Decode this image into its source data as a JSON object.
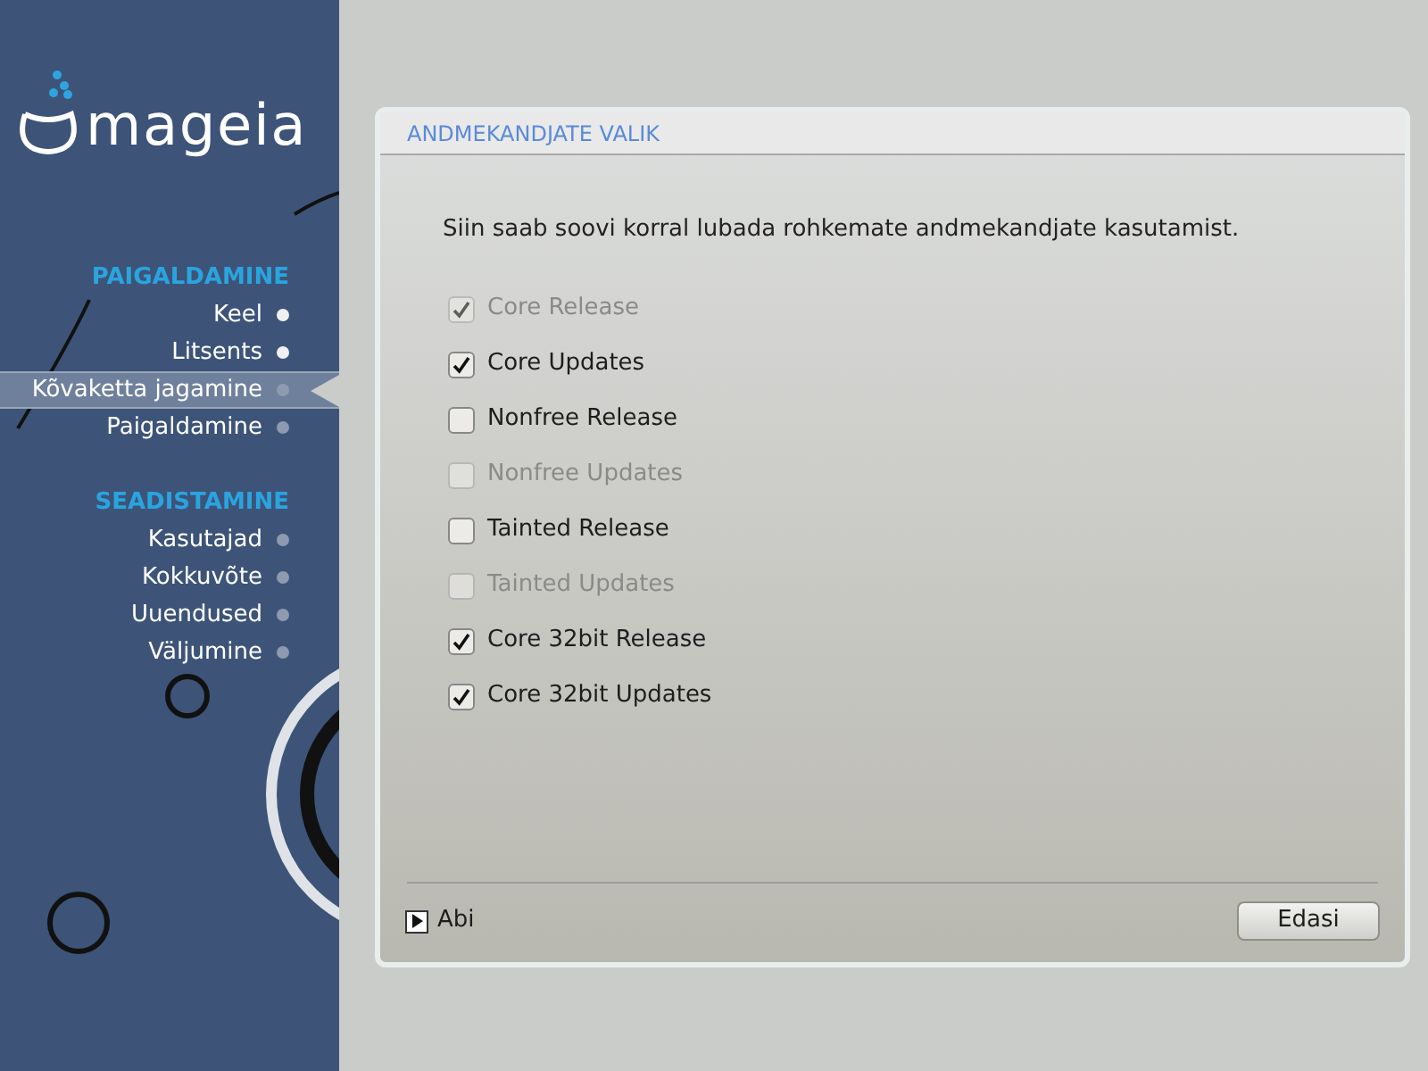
{
  "logo": {
    "text": "mageia"
  },
  "sidebar": {
    "sections": [
      {
        "title": "PAIGALDAMINE",
        "items": [
          {
            "label": "Keel",
            "selected": false,
            "done": true
          },
          {
            "label": "Litsents",
            "selected": false,
            "done": true
          },
          {
            "label": "Kõvaketta jagamine",
            "selected": true,
            "done": false
          },
          {
            "label": "Paigaldamine",
            "selected": false,
            "done": false
          }
        ]
      },
      {
        "title": "SEADISTAMINE",
        "items": [
          {
            "label": "Kasutajad",
            "selected": false,
            "done": false
          },
          {
            "label": "Kokkuvõte",
            "selected": false,
            "done": false
          },
          {
            "label": "Uuendused",
            "selected": false,
            "done": false
          },
          {
            "label": "Väljumine",
            "selected": false,
            "done": false
          }
        ]
      }
    ]
  },
  "panel": {
    "title": "ANDMEKANDJATE VALIK",
    "description": "Siin saab soovi korral lubada rohkemate andmekandjate kasutamist.",
    "options": [
      {
        "label": "Core Release",
        "checked": true,
        "disabled": true
      },
      {
        "label": "Core Updates",
        "checked": true,
        "disabled": false
      },
      {
        "label": "Nonfree Release",
        "checked": false,
        "disabled": false
      },
      {
        "label": "Nonfree Updates",
        "checked": false,
        "disabled": true
      },
      {
        "label": "Tainted Release",
        "checked": false,
        "disabled": false
      },
      {
        "label": "Tainted Updates",
        "checked": false,
        "disabled": true
      },
      {
        "label": "Core 32bit Release",
        "checked": true,
        "disabled": false
      },
      {
        "label": "Core 32bit Updates",
        "checked": true,
        "disabled": false
      }
    ],
    "help": {
      "label": "Abi",
      "expanded": false
    },
    "next_button": "Edasi"
  }
}
